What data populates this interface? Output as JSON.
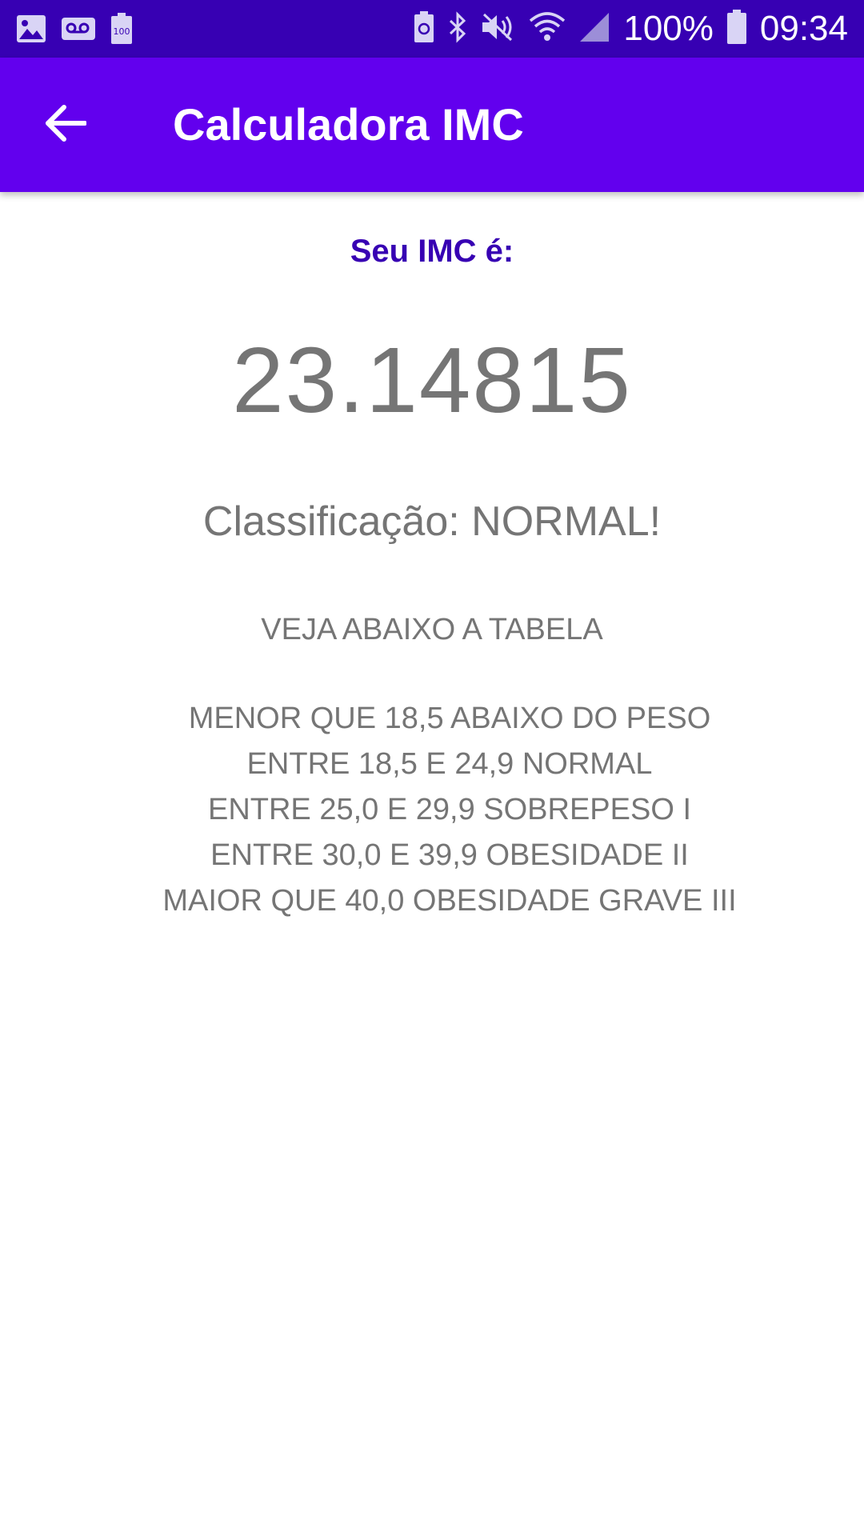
{
  "status_bar": {
    "battery_percent": "100%",
    "time": "09:34",
    "left_icons": [
      "image-icon",
      "voicemail-icon",
      "battery-saver-icon"
    ],
    "right_icons": [
      "battery-recycle-icon",
      "bluetooth-icon",
      "mute-icon",
      "wifi-icon",
      "signal-icon",
      "battery-icon"
    ]
  },
  "app_bar": {
    "title": "Calculadora IMC",
    "back_icon": "arrow-back-icon",
    "color": "#6200ee"
  },
  "result": {
    "label": "Seu IMC é:",
    "value": "23.14815",
    "classification": "Classificação: NORMAL!"
  },
  "table": {
    "heading": "VEJA ABAIXO A TABELA",
    "rows": [
      "MENOR QUE 18,5 ABAIXO DO PESO",
      "ENTRE 18,5 E 24,9 NORMAL",
      "ENTRE 25,0 E 29,9 SOBREPESO I",
      "ENTRE 30,0 E 39,9 OBESIDADE II",
      "MAIOR QUE 40,0 OBESIDADE GRAVE III"
    ]
  },
  "colors": {
    "status_bar": "#3700b3",
    "accent_text": "#3700b3",
    "body_text": "#757575"
  }
}
